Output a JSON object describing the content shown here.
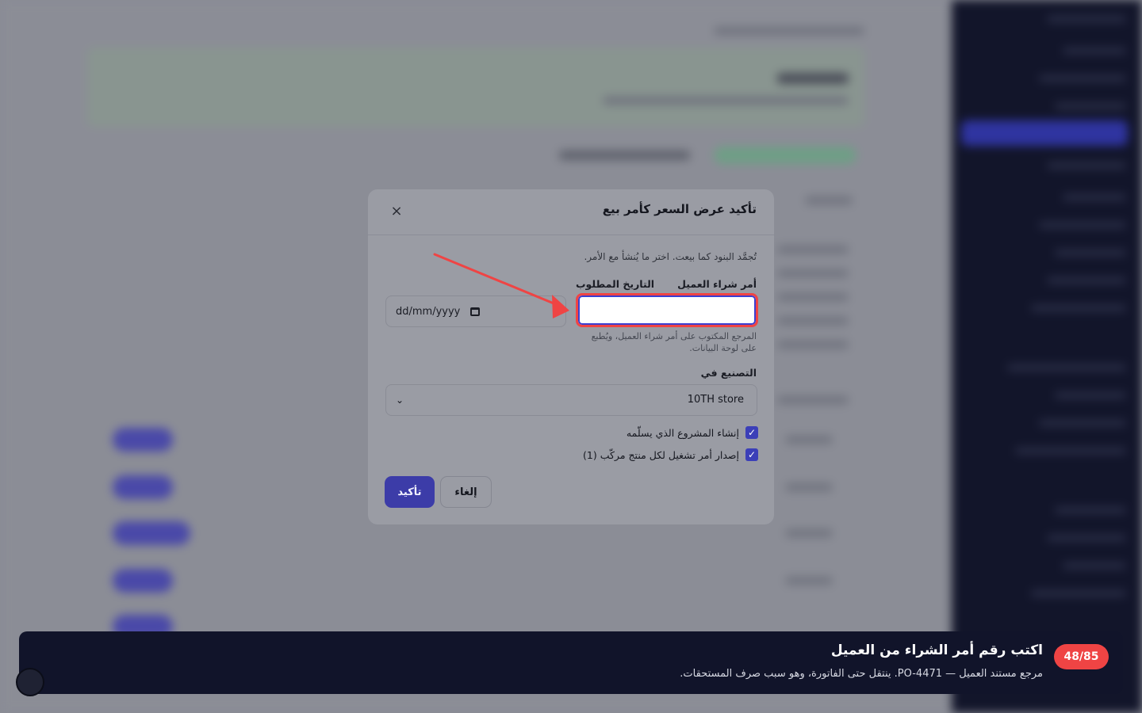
{
  "modal": {
    "title": "تأكيد عرض السعر كأمر بيع",
    "intro": "تُجمَّد البنود كما بيعت. اختر ما يُنشأ مع الأمر.",
    "po_label": "أمر شراء العميل",
    "po_value": "",
    "po_hint": "المرجع المكتوب على أمر شراء العميل، ويُطبع على لوحة البيانات.",
    "date_label": "التاريخ المطلوب",
    "date_placeholder": "dd/mm/yyyy",
    "manufacture_label": "التصنيع في",
    "manufacture_value": "10TH store",
    "checkbox_project": "إنشاء المشروع الذي يسلّمه",
    "checkbox_work_order": "إصدار أمر تشغيل لكل منتج مركّب (1)",
    "confirm_label": "تأكيد",
    "cancel_label": "إلغاء",
    "close_glyph": "×"
  },
  "tour": {
    "progress": "48/85",
    "title": "اكتب رقم أمر الشراء من العميل",
    "subtitle": "مرجع مستند العميل — PO-4471. ينتقل حتى الفاتورة، وهو سبب صرف المستحقات."
  },
  "colors": {
    "accent": "#3c3ca8",
    "highlight": "#ef4444",
    "tour_bg": "#11142a"
  }
}
